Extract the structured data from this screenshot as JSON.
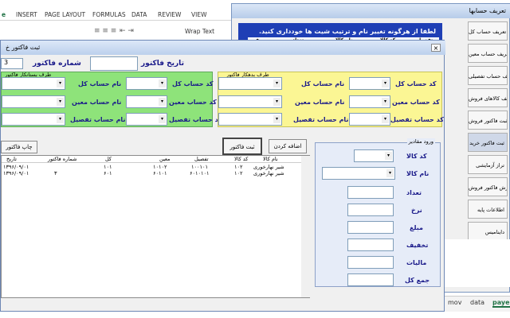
{
  "excel": {
    "tabs": [
      "e",
      "INSERT",
      "PAGE LAYOUT",
      "FORMULAS",
      "DATA",
      "REVIEW",
      "VIEW"
    ],
    "ribbon_wrap_text": "Wrap Text",
    "sheet_tabs": [
      "mov",
      "data",
      "paye"
    ]
  },
  "back_dialog": {
    "title": "تعريف حسابها",
    "message": "لطفا از هرگونه تغییر نام و ترتیب شیت ها خودداری کنید.",
    "grid_headers": [
      "تفصیل",
      "کد کالا",
      "نام کالا",
      "تعداد",
      "فی"
    ],
    "side_buttons": [
      "تعریف حساب کل",
      "تعریف حساب معین",
      "تعریف حساب تفصیلی",
      "تعریف کالاهای فروش",
      "ثبت فاکتور فروش",
      "ثبت فاکتور خرید",
      "تراز آزمایشی",
      "گزارش فاکتور فروش",
      "اطلاعات پایه",
      "داینامیس"
    ]
  },
  "main_dialog": {
    "title": "ثبت فاکتور خ",
    "close": "×",
    "invoice_number_label": "شماره فاکتور",
    "invoice_number_value": "3",
    "invoice_date_label": "تاریخ فاکتور",
    "debtor_panel": {
      "caption": "طرف بدهکار فاکتور",
      "rows": [
        {
          "code_label": "کد حساب کل",
          "name_label": "نام حساب کل"
        },
        {
          "code_label": "کد حساب معین",
          "name_label": "نام حساب معین"
        },
        {
          "code_label": "کد حساب تفصیل",
          "name_label": "نام حساب تفصیل"
        }
      ]
    },
    "creditor_panel": {
      "caption": "طرف بستانکار فاکتور",
      "rows": [
        {
          "code_label": "کد حساب کل",
          "name_label": "نام حساب کل"
        },
        {
          "code_label": "کد حساب معین",
          "name_label": "نام حساب معین"
        },
        {
          "code_label": "کد حساب تفصیل",
          "name_label": "نام حساب تفصیل"
        }
      ]
    },
    "buttons": {
      "print": "چاپ فاکتور",
      "register": "ثبت فاکتور",
      "add": "اضافه کردن"
    },
    "grid": {
      "headers": [
        "تاریخ",
        "شماره فاکتور",
        "کل",
        "معین",
        "تفصیل",
        "کد کالا",
        "نام کالا"
      ],
      "rows": [
        [
          "۱۳۹۶/۰۹/۰۱",
          "",
          "۱۰۱",
          "۱۰۱۰۲",
          "۱۰۰۱۰۱",
          "۱۰۲",
          "شیر نهارخوری"
        ],
        [
          "۱۳۹۶/۰۹/۰۱",
          "۳",
          "۶۰۱",
          "۶۰۱۰۱",
          "۶۰۱۰۱۰۱",
          "۱۰۲",
          "شیر نهارخوری"
        ]
      ]
    },
    "entry": {
      "caption": "ورود مقادیر",
      "fields": [
        "کد کالا",
        "نام کالا",
        "تعداد",
        "نرخ",
        "مبلغ",
        "تخفیف",
        "مالیات",
        "جمع کل"
      ]
    }
  }
}
